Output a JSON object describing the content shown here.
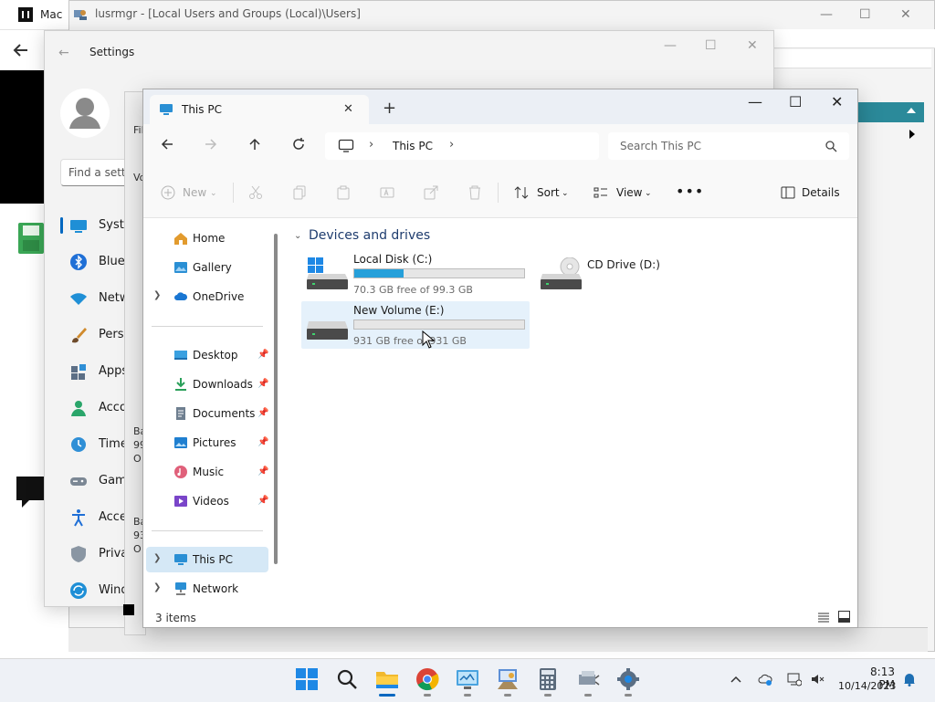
{
  "background": {
    "mac_title": "Mac",
    "lusrmgr_title": "lusrmgr - [Local Users and Groups (Local)\\Users]",
    "mid_strip_items": [
      "Fil",
      "Vo",
      "Ba",
      "99",
      "O",
      "Ba",
      "93",
      "O"
    ]
  },
  "settings": {
    "title": "Settings",
    "search_placeholder": "Find a setting",
    "nav": [
      {
        "label": "System",
        "icon": "system-icon"
      },
      {
        "label": "Bluetooth & devices",
        "icon": "bluetooth-icon"
      },
      {
        "label": "Network & internet",
        "icon": "network-icon"
      },
      {
        "label": "Personalization",
        "icon": "brush-icon"
      },
      {
        "label": "Apps",
        "icon": "apps-icon"
      },
      {
        "label": "Accounts",
        "icon": "accounts-icon"
      },
      {
        "label": "Time & language",
        "icon": "time-icon"
      },
      {
        "label": "Gaming",
        "icon": "gaming-icon"
      },
      {
        "label": "Accessibility",
        "icon": "accessibility-icon"
      },
      {
        "label": "Privacy & security",
        "icon": "shield-icon"
      },
      {
        "label": "Windows Update",
        "icon": "update-icon"
      }
    ]
  },
  "explorer": {
    "tab_label": "This PC",
    "breadcrumb": "This PC",
    "search_placeholder": "Search This PC",
    "cmd": {
      "new": "New",
      "sort": "Sort",
      "view": "View",
      "details": "Details"
    },
    "nav_pane": {
      "home": "Home",
      "gallery": "Gallery",
      "onedrive": "OneDrive",
      "desktop": "Desktop",
      "downloads": "Downloads",
      "documents": "Documents",
      "pictures": "Pictures",
      "music": "Music",
      "videos": "Videos",
      "thispc": "This PC",
      "network": "Network"
    },
    "group_header": "Devices and drives",
    "drives": [
      {
        "name": "Local Disk (C:)",
        "free_text": "70.3 GB free of 99.3 GB",
        "used_fraction": 0.292
      },
      {
        "name": "CD Drive (D:)"
      },
      {
        "name": "New Volume (E:)",
        "free_text": "931 GB free of 931 GB",
        "used_fraction": 0.0
      }
    ],
    "status": "3 items",
    "accent": "#26a0da"
  },
  "taskbar": {
    "apps": [
      "start-icon",
      "search-icon",
      "file-explorer-icon",
      "chrome-icon",
      "control-panel-icon",
      "remote-desktop-icon",
      "calculator-icon",
      "network-tool-icon",
      "settings-gear-icon"
    ],
    "time": "8:13 PM",
    "date": "10/14/2023"
  }
}
